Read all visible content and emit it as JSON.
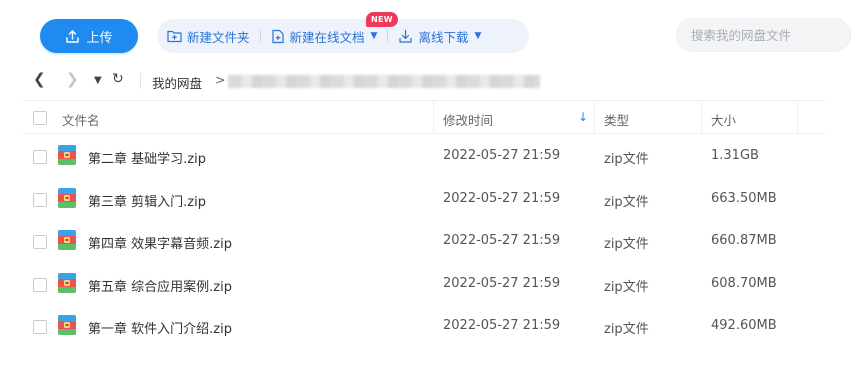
{
  "toolbar": {
    "upload_label": "上传",
    "new_folder_label": "新建文件夹",
    "new_online_doc_label": "新建在线文档",
    "new_badge": "NEW",
    "offline_download_label": "离线下载",
    "search_placeholder": "搜索我的网盘文件",
    "accent_color": "#1f8af0"
  },
  "nav": {
    "breadcrumb_root": "我的网盘",
    "breadcrumb_separator": ">"
  },
  "table": {
    "columns": {
      "name": "文件名",
      "modified": "修改时间",
      "type": "类型",
      "size": "大小"
    },
    "sort_column": "修改时间",
    "sort_direction": "descending",
    "rows": [
      {
        "name": "第二章 基础学习.zip",
        "modified": "2022-05-27 21:59",
        "type": "zip文件",
        "size": "1.31GB"
      },
      {
        "name": "第三章 剪辑入门.zip",
        "modified": "2022-05-27 21:59",
        "type": "zip文件",
        "size": "663.50MB"
      },
      {
        "name": "第四章 效果字幕音频.zip",
        "modified": "2022-05-27 21:59",
        "type": "zip文件",
        "size": "660.87MB"
      },
      {
        "name": "第五章 综合应用案例.zip",
        "modified": "2022-05-27 21:59",
        "type": "zip文件",
        "size": "608.70MB"
      },
      {
        "name": "第一章 软件入门介绍.zip",
        "modified": "2022-05-27 21:59",
        "type": "zip文件",
        "size": "492.60MB"
      }
    ]
  }
}
